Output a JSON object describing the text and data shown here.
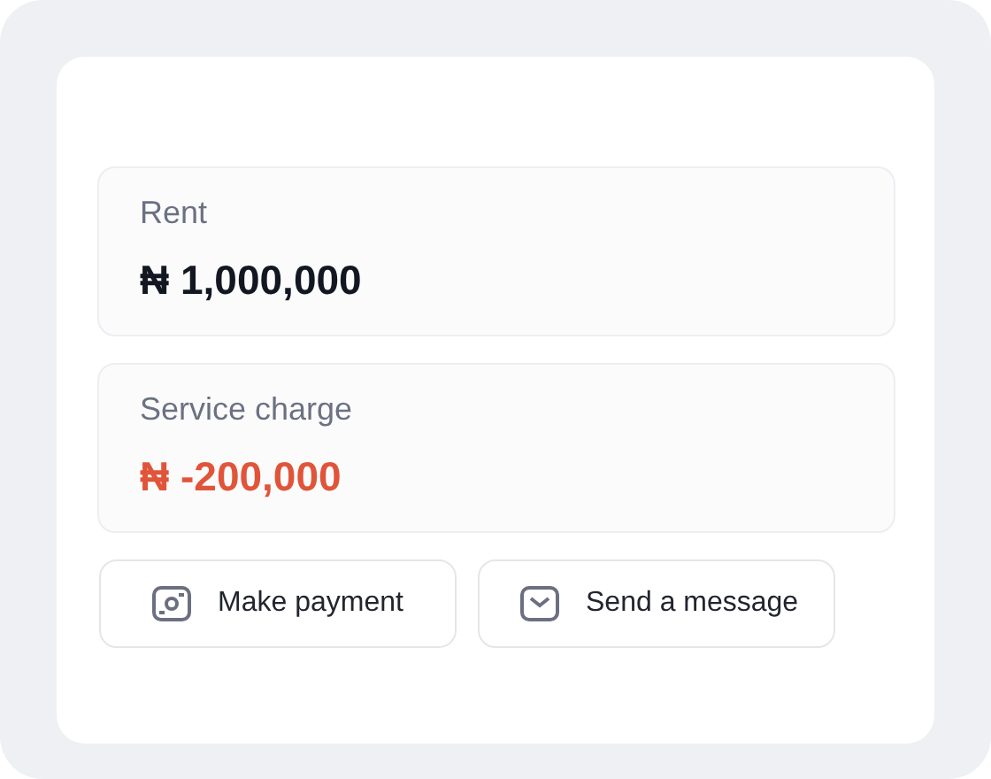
{
  "charges": [
    {
      "label": "Rent",
      "amount": "₦ 1,000,000",
      "kind": "charge"
    },
    {
      "label": "Service charge",
      "amount": "₦ -200,000",
      "kind": "deduction"
    }
  ],
  "buttons": [
    {
      "label": "Make payment",
      "kind": "payment"
    },
    {
      "label": "Send a message",
      "kind": "message"
    }
  ]
}
